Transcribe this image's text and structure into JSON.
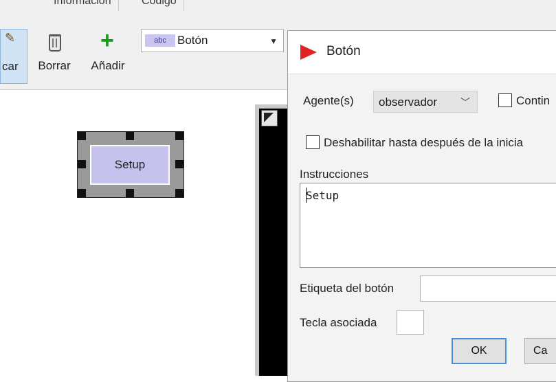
{
  "tabs": [
    "Información",
    "Código"
  ],
  "toolbar": {
    "edit_partial": "car",
    "delete_label": "Borrar",
    "add_label": "Añadir",
    "widget_type_icon": "abc",
    "widget_type_value": "Botón"
  },
  "canvas": {
    "widget_label": "Setup"
  },
  "dialog": {
    "title": "Botón",
    "agents_label": "Agente(s)",
    "agents_value": "observador",
    "continuous_label": "Contin",
    "disable_label": "Deshabilitar hasta después de la inicia",
    "commands_label": "Instrucciones",
    "commands_value": "Setup",
    "display_name_label": "Etiqueta del botón",
    "display_name_value": "",
    "action_key_label": "Tecla asociada",
    "action_key_value": "",
    "ok_label": "OK",
    "cancel_partial": "Ca"
  },
  "colors": {
    "widget_button": "#c5c3ee",
    "logo": "#e02424",
    "add_icon": "#1d9a1d",
    "ok_border": "#4a90d9"
  },
  "icons": [
    "edit-icon",
    "delete-icon",
    "add-icon",
    "abc-widget-icon",
    "dropdown-arrow-icon",
    "netlogo-logo",
    "chevron-down-icon",
    "view-icon"
  ]
}
